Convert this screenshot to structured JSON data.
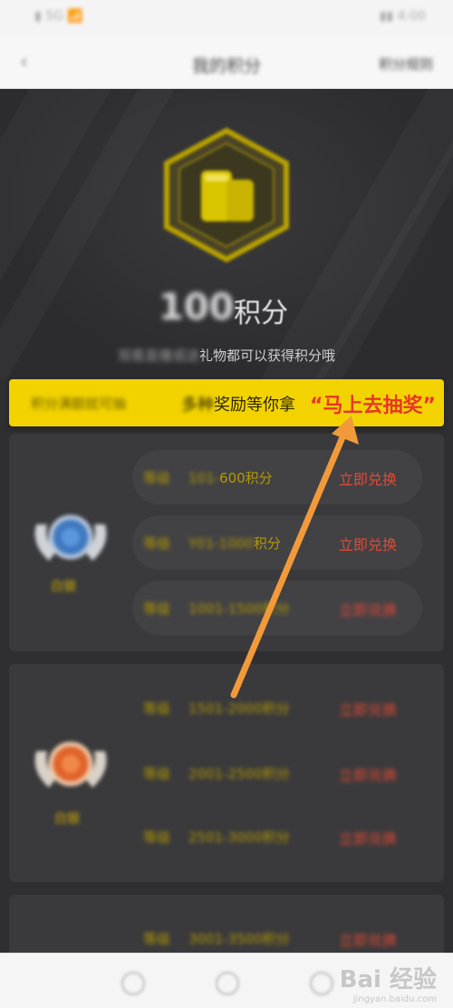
{
  "status_bar": {
    "left": "▮ 5G 📶",
    "right": "▮▮ 4:00"
  },
  "header": {
    "title": "我的积分",
    "right_link": "积分规则"
  },
  "hero": {
    "points_value": "100",
    "points_unit": "积分",
    "hint_blurred": "观看直播或送",
    "hint_visible": "礼物都可以获得积分哦"
  },
  "banner": {
    "blurred_text": "积分满额就可抽",
    "visible_text_blur": "多种",
    "visible_text": "奖励等你拿",
    "cta": "“马上去抽奖”"
  },
  "tiers": [
    {
      "medal_label": "白银",
      "medal_color": "#4a8fd6",
      "rows": [
        {
          "level": "等级",
          "range_blur": "101-",
          "range_visible": "600积分",
          "action": "立即兑换"
        },
        {
          "level": "等级",
          "range_blur": "Y01-1000",
          "range_visible": "积分",
          "action": "立即兑换"
        },
        {
          "level": "等级",
          "range_blur": "1001-1500积分",
          "range_visible": "",
          "action": "立即兑换"
        }
      ]
    },
    {
      "medal_label": "白银",
      "medal_color": "#e86a2a",
      "rows": [
        {
          "level": "等级",
          "range_blur": "1501-2000积分",
          "range_visible": "",
          "action": "立即兑换"
        },
        {
          "level": "等级",
          "range_blur": "2001-2500积分",
          "range_visible": "",
          "action": "立即兑换"
        },
        {
          "level": "等级",
          "range_blur": "2501-3000积分",
          "range_visible": "",
          "action": "立即兑换"
        }
      ]
    },
    {
      "medal_label": "",
      "medal_color": "#888888",
      "rows": [
        {
          "level": "等级",
          "range_blur": "3001-3500积分",
          "range_visible": "",
          "action": "立即兑换"
        }
      ]
    }
  ],
  "watermark": {
    "brand": "Bai 经验",
    "url": "jingyan.baidu.com"
  },
  "colors": {
    "accent_yellow": "#f2d300",
    "cta_red": "#e8352a",
    "arrow_orange": "#f29a3a"
  }
}
